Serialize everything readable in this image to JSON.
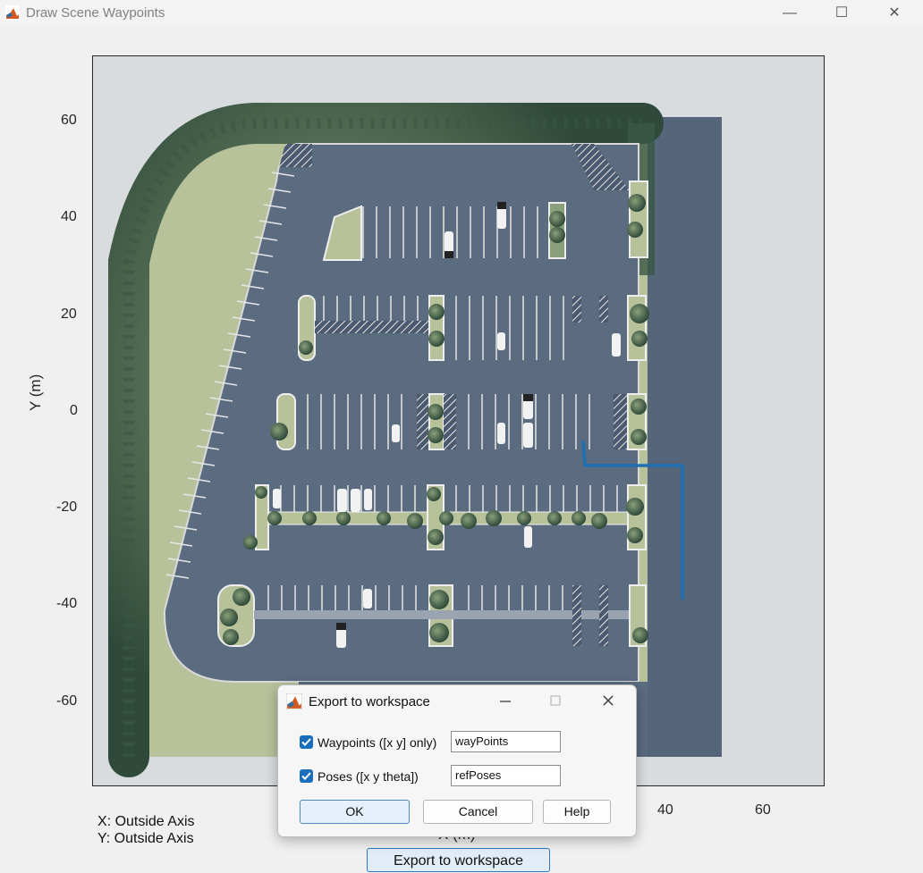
{
  "window": {
    "title": "Draw Scene Waypoints",
    "minimize_glyph": "—",
    "maximize_glyph": "☐",
    "close_glyph": "✕"
  },
  "axes": {
    "ylabel": "Y (m)",
    "xlabel": "X (m)",
    "y_ticks": [
      "60",
      "40",
      "20",
      "0",
      "-20",
      "-40",
      "-60"
    ],
    "x_ticks_visible": [
      "40",
      "60"
    ],
    "image_description_icons": [
      "parking-lot-image",
      "trees",
      "cars",
      "handicap-icons"
    ]
  },
  "waypoint_path": {
    "color": "#1f6fb2",
    "points_xy_m": [
      [
        36,
        -6
      ],
      [
        36.5,
        -11
      ],
      [
        43,
        -11
      ],
      [
        43,
        -38.5
      ]
    ]
  },
  "readout": {
    "x_text": "X: Outside Axis",
    "y_text": "Y: Outside Axis"
  },
  "export_button": {
    "label": "Export to workspace"
  },
  "dialog": {
    "title": "Export to workspace",
    "waypoints_label": "Waypoints ([x y] only)",
    "waypoints_value": "wayPoints",
    "waypoints_checked": true,
    "poses_label": "Poses ([x y theta])",
    "poses_value": "refPoses",
    "poses_checked": true,
    "ok_label": "OK",
    "cancel_label": "Cancel",
    "help_label": "Help"
  }
}
